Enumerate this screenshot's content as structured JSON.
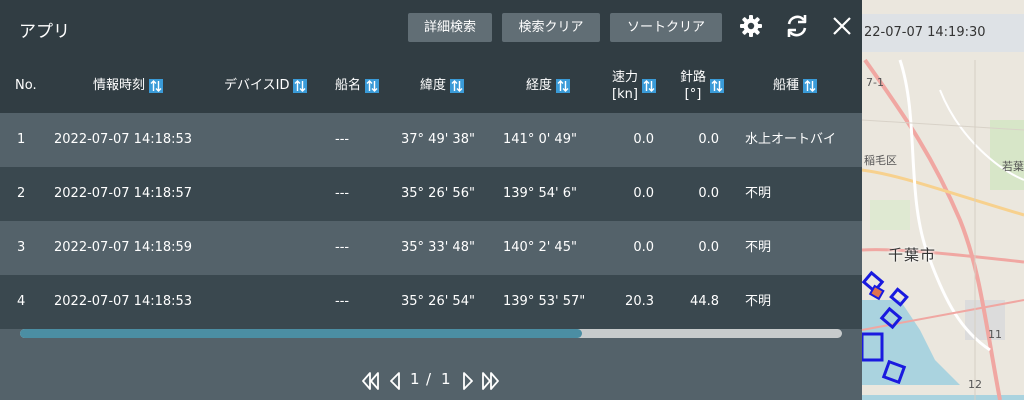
{
  "map": {
    "timestamp": "22-07-07 14:19:30",
    "city_label": "千葉市",
    "labels": [
      "7-1",
      "稲毛区",
      "若葉",
      "11",
      "12"
    ]
  },
  "app": {
    "title": "アプリ",
    "buttons": {
      "detail_search": "詳細検索",
      "search_clear": "検索クリア",
      "sort_clear": "ソートクリア"
    }
  },
  "table": {
    "headers": {
      "no": "No.",
      "time": "情報時刻",
      "device": "デバイスID",
      "ship": "船名",
      "lat": "緯度",
      "lon": "経度",
      "speed": "速力",
      "speed_unit": "[kn]",
      "course": "針路",
      "course_unit": "[°]",
      "type": "船種"
    },
    "rows": [
      {
        "no": "1",
        "time": "2022-07-07 14:18:53",
        "device": "",
        "ship": "---",
        "lat": "37° 49' 38\"",
        "lon": "141° 0' 49\"",
        "speed": "0.0",
        "course": "0.0",
        "type": "水上オートバイ"
      },
      {
        "no": "2",
        "time": "2022-07-07 14:18:57",
        "device": "",
        "ship": "---",
        "lat": "35° 26' 56\"",
        "lon": "139° 54' 6\"",
        "speed": "0.0",
        "course": "0.0",
        "type": "不明"
      },
      {
        "no": "3",
        "time": "2022-07-07 14:18:59",
        "device": "",
        "ship": "---",
        "lat": "35° 33' 48\"",
        "lon": "140° 2' 45\"",
        "speed": "0.0",
        "course": "0.0",
        "type": "不明"
      },
      {
        "no": "4",
        "time": "2022-07-07 14:18:53",
        "device": "",
        "ship": "---",
        "lat": "35° 26' 54\"",
        "lon": "139° 53' 57\"",
        "speed": "20.3",
        "course": "44.8",
        "type": "不明"
      }
    ]
  },
  "pager": {
    "current": "1",
    "separator": "/",
    "total": "1"
  },
  "colors": {
    "titlebar": "#313d43",
    "panel": "#54626a",
    "row_alt": "#3a484f",
    "button": "#616e75",
    "sort_icon": "#3a9bd8",
    "scroll_thumb": "#4b8ea3",
    "ship_marker": "#1a1adf"
  },
  "icons": [
    "gear-icon",
    "refresh-icon",
    "close-icon",
    "sort-icon",
    "first-page-icon",
    "prev-page-icon",
    "next-page-icon",
    "last-page-icon"
  ]
}
